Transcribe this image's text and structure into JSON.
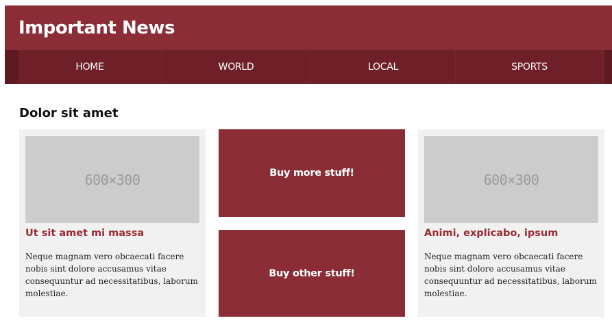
{
  "header": {
    "title": "Important News",
    "nav": [
      {
        "label": "HOME"
      },
      {
        "label": "WORLD"
      },
      {
        "label": "LOCAL"
      },
      {
        "label": "SPORTS"
      }
    ]
  },
  "main": {
    "section_title": "Dolor sit amet",
    "cards": [
      {
        "image_label": "600×300",
        "title": "Ut sit amet mi massa",
        "text": "Neque magnam vero obcaecati facere nobis sint dolore accusamus vitae consequuntur ad necessitatibus, laborum molestiae."
      },
      {
        "image_label": "600×300",
        "title": "Animi, explicabo, ipsum",
        "text": "Neque magnam vero obcaecati facere nobis sint dolore accusamus vitae consequuntur ad necessitatibus, laborum molestiae."
      }
    ],
    "ads": [
      {
        "label": "Buy more stuff!"
      },
      {
        "label": "Buy other stuff!"
      }
    ]
  },
  "colors": {
    "brand": "#8b2d36",
    "nav_background": "#6e1f27",
    "card_background": "#f1f1f1",
    "placeholder_background": "#cccccc",
    "card_title": "#9b2a34"
  }
}
